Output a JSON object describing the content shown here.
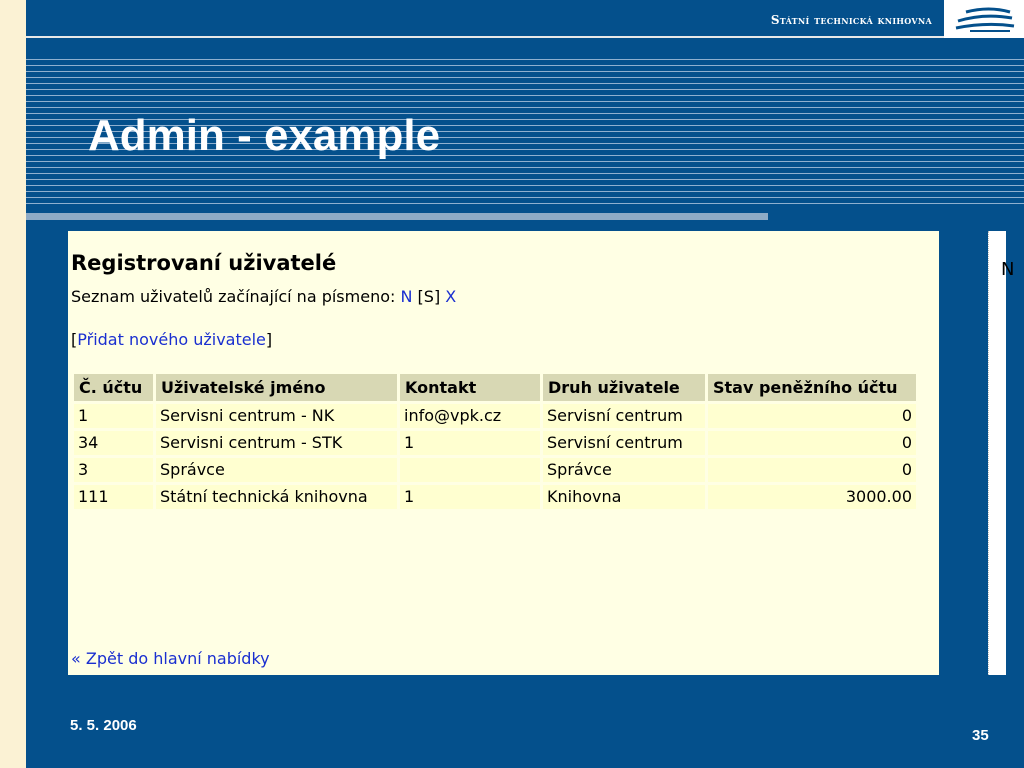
{
  "header": {
    "brand": "Státní technická knihovna",
    "logo_icon": "stk-logo-icon"
  },
  "slide": {
    "title": "Admin -  example",
    "date": "5. 5. 2006",
    "page": "35"
  },
  "screenshot": {
    "heading": "Registrovaní uživatelé",
    "filter_prefix": "Seznam uživatelů začínající na písmeno:",
    "filter_links": [
      "N",
      "[S]",
      "X"
    ],
    "add_link": "Přidat nového uživatele",
    "table": {
      "headers": [
        "Č. účtu",
        "Uživatelské jméno",
        "Kontakt",
        "Druh uživatele",
        "Stav peněžního účtu"
      ],
      "rows": [
        [
          "1",
          "Servisni centrum - NK",
          "info@vpk.cz",
          "Servisní centrum",
          "0"
        ],
        [
          "34",
          "Servisni centrum - STK",
          "1",
          "Servisní centrum",
          "0"
        ],
        [
          "3",
          "Správce",
          "",
          "Správce",
          "0"
        ],
        [
          "111",
          "Státní technická knihovna",
          "1",
          "Knihovna",
          "3000.00"
        ]
      ]
    },
    "back_link": "« Zpět do hlavní nabídky",
    "edge_glyph": "N"
  },
  "colors": {
    "background": "#04508c",
    "panel": "#ffffe4",
    "link": "#1a2fd0",
    "header_cell": "#d8d8b4",
    "cell": "#ffffd0"
  }
}
